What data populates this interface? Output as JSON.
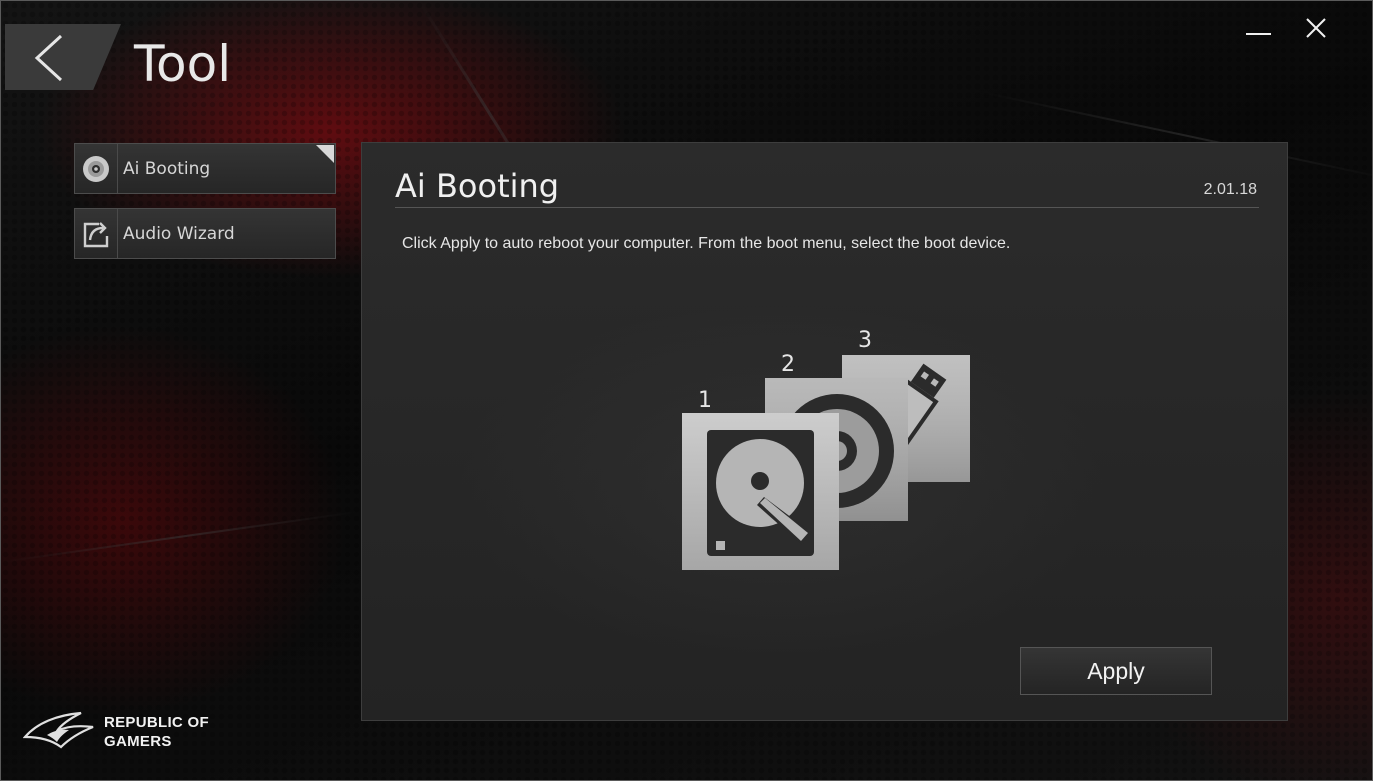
{
  "window": {
    "title": "Tool",
    "controls": {
      "minimize_icon": "minimize-icon",
      "close_icon": "close-icon"
    }
  },
  "back_icon": "chevron-left-icon",
  "sidebar": {
    "items": [
      {
        "label": "Ai Booting",
        "icon": "disc-icon",
        "selected": true
      },
      {
        "label": "Audio Wizard",
        "icon": "export-icon",
        "selected": false
      }
    ]
  },
  "panel": {
    "title": "Ai Booting",
    "version": "2.01.18",
    "description": "Click Apply to auto reboot your computer. From the boot menu, select the boot device.",
    "boot_devices": [
      {
        "order": "1",
        "icon": "hard-drive-icon"
      },
      {
        "order": "2",
        "icon": "optical-disc-icon"
      },
      {
        "order": "3",
        "icon": "usb-drive-icon"
      }
    ],
    "apply_label": "Apply"
  },
  "brand": {
    "line1": "REPUBLIC OF",
    "line2": "GAMERS"
  },
  "colors": {
    "accent_red": "#a00a10",
    "panel_bg": "#282828",
    "text": "#e6e6e6"
  }
}
